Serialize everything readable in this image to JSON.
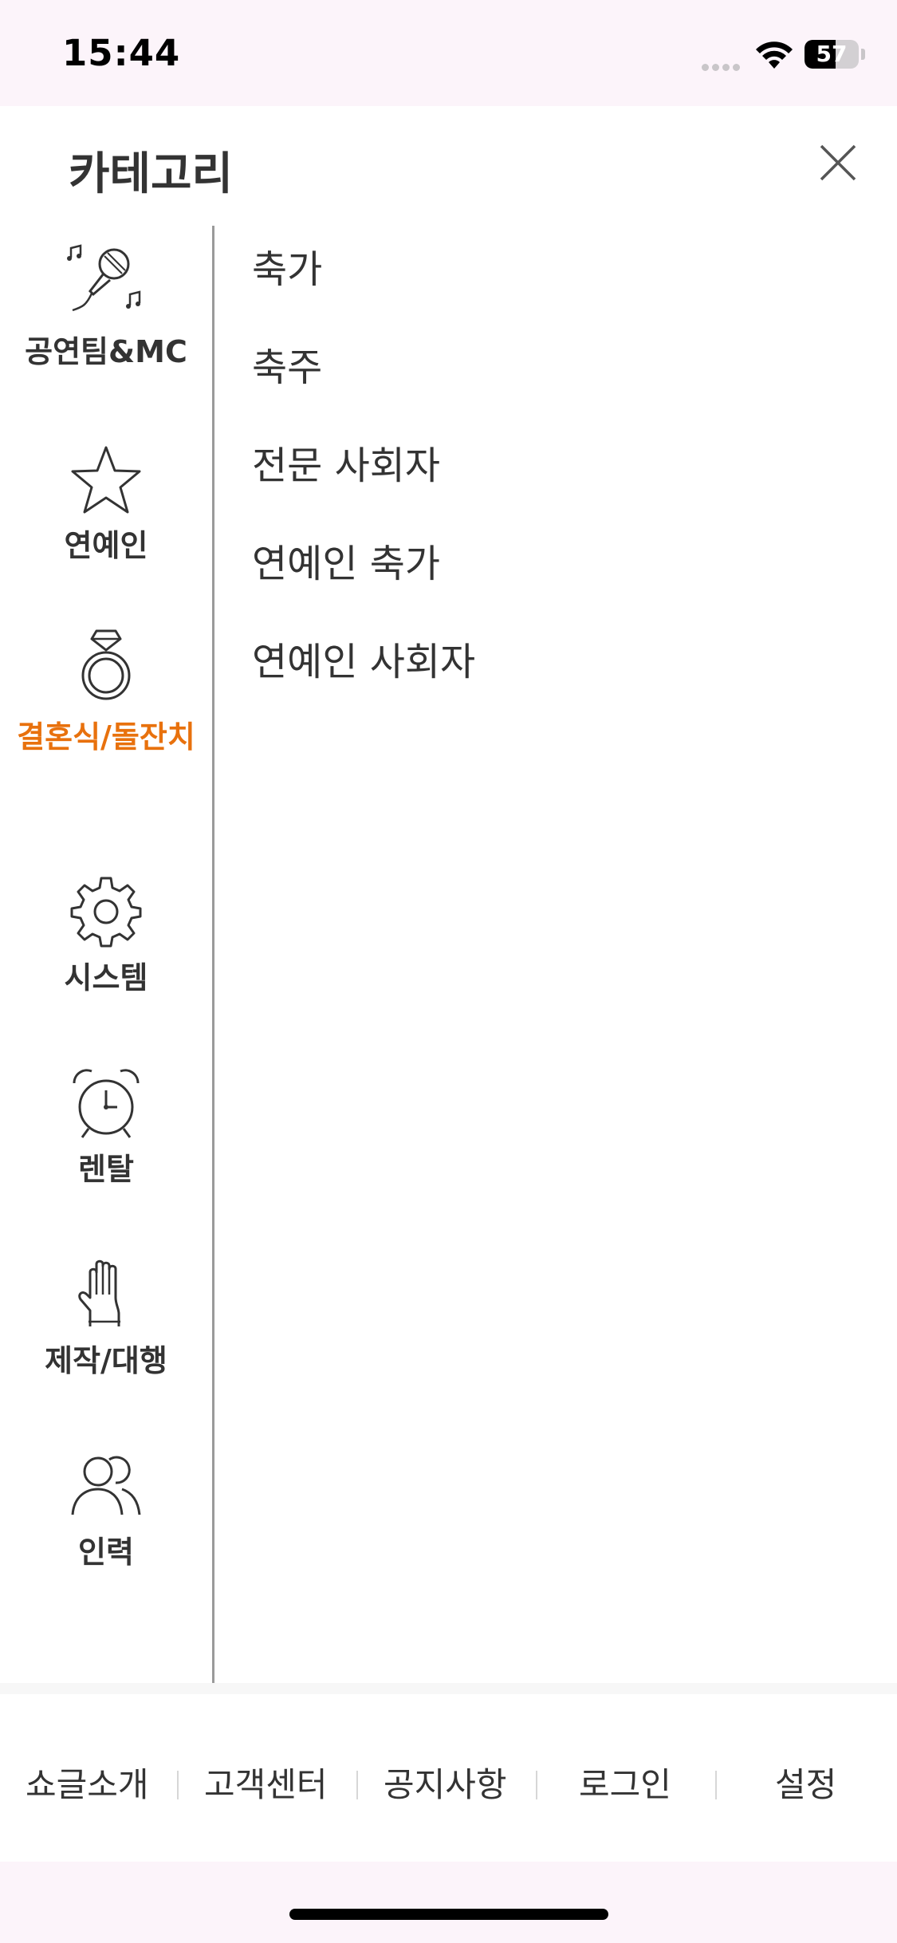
{
  "status_bar": {
    "time": "15:44",
    "battery": "57",
    "battery_level": 0.57
  },
  "sheet": {
    "title": "카테고리",
    "close_icon": "close-icon"
  },
  "sidebar": {
    "items": [
      {
        "label": "공연팀&MC",
        "icon": "microphone-icon",
        "active": false
      },
      {
        "label": "연예인",
        "icon": "star-icon",
        "active": false
      },
      {
        "label": "결혼식/돌잔치",
        "icon": "ring-icon",
        "active": true
      },
      {
        "label": "시스템",
        "icon": "gear-icon",
        "active": false
      },
      {
        "label": "렌탈",
        "icon": "alarm-clock-icon",
        "active": false
      },
      {
        "label": "제작/대행",
        "icon": "glove-icon",
        "active": false
      },
      {
        "label": "인력",
        "icon": "people-icon",
        "active": false
      }
    ],
    "active_color": "#e8710d"
  },
  "subcategories": [
    "축가",
    "축주",
    "전문 사회자",
    "연예인 축가",
    "연예인 사회자"
  ],
  "footer": {
    "links": [
      "쇼글소개",
      "고객센터",
      "공지사항",
      "로그인",
      "설정"
    ]
  }
}
